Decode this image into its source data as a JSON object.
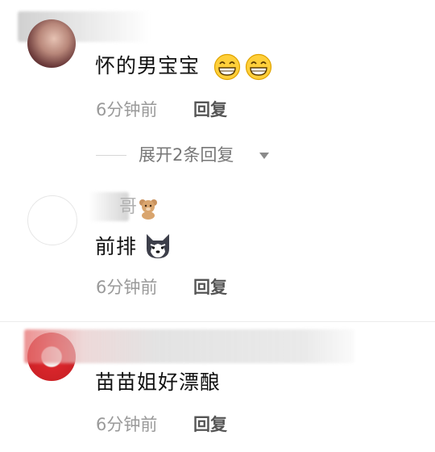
{
  "comments": [
    {
      "text": "怀的男宝宝",
      "emojis": [
        "grinning-face-icon",
        "grinning-face-icon"
      ],
      "time": "6分钟前",
      "reply_label": "回复",
      "expand_label": "展开2条回复"
    },
    {
      "text": "前排",
      "emojis": [
        "husky-dog-icon"
      ],
      "name_suffix": "哥",
      "name_emoji": "teddy-bear-icon",
      "time": "6分钟前",
      "reply_label": "回复"
    },
    {
      "text": "苗苗姐好漂酿",
      "time": "6分钟前",
      "reply_label": "回复"
    }
  ],
  "colors": {
    "time": "#9a9a9a",
    "reply": "#555555",
    "text": "#111111",
    "avatar_red": "#d9262b"
  }
}
